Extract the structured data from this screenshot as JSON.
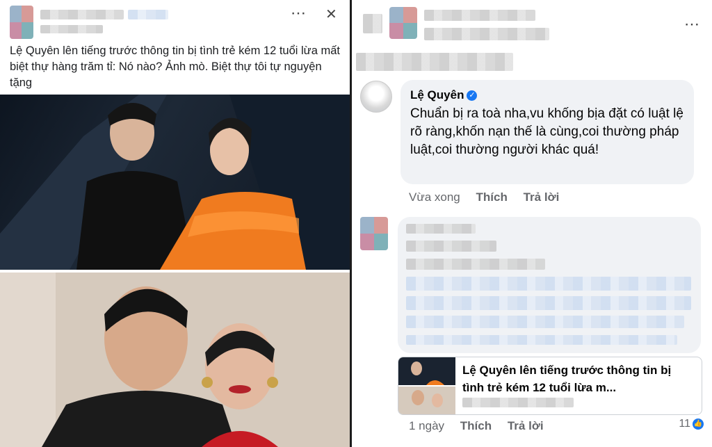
{
  "left_post": {
    "text": "Lệ Quyên lên tiếng trước thông tin bị tình trẻ kém 12 tuổi lừa mất biệt thự hàng trăm tỉ: Nó nào? Ảnh mò. Biệt thự tôi tự nguyện tặng",
    "more_icon": "⋯",
    "close_icon": "✕"
  },
  "right_panel": {
    "more_icon": "⋯",
    "comment1": {
      "author": "Lệ Quyên",
      "verified_icon": "✓",
      "text": "Chuẩn bị ra toà nha,vu khống bịa đặt có luật lệ rõ ràng,khốn nạn thế là cùng,coi thường pháp luật,coi thường người khác quá!",
      "time": "Vừa xong",
      "like": "Thích",
      "reply": "Trả lời"
    },
    "comment2": {
      "link_title": "Lệ Quyên lên tiếng trước thông tin bị tình trẻ kém 12 tuổi lừa m...",
      "time": "1 ngày",
      "like": "Thích",
      "reply": "Trả lời",
      "like_count": "11",
      "like_icon": "👍"
    }
  },
  "colors": {
    "accent": "#1877f2",
    "secondary_text": "#65676b",
    "bubble": "#f0f2f5"
  }
}
